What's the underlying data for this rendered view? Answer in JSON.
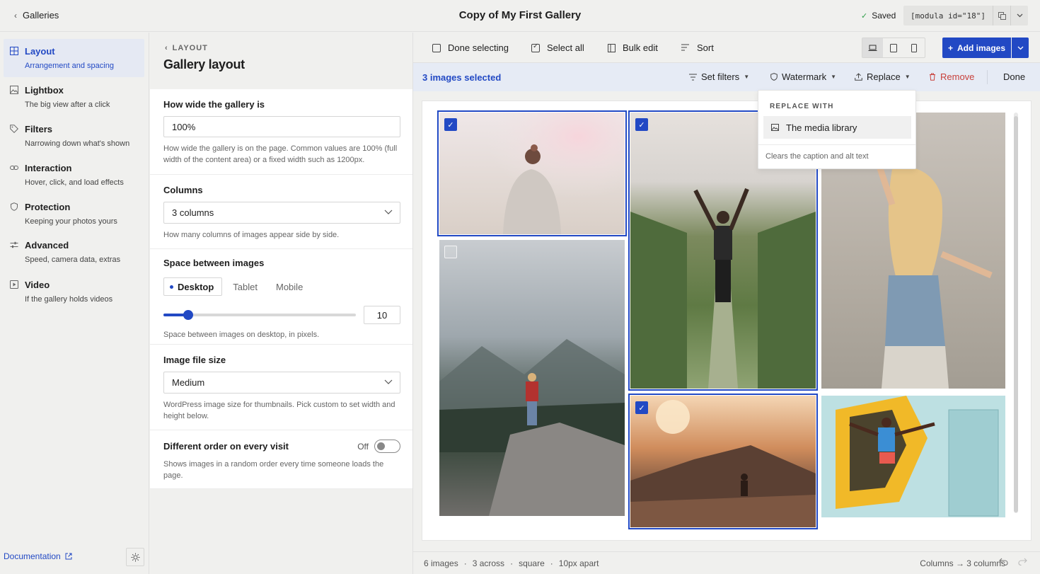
{
  "header": {
    "back_label": "Galleries",
    "title": "Copy of My First Gallery",
    "saved_label": "Saved",
    "shortcode": "[modula id=\"18\"]"
  },
  "nav": {
    "items": [
      {
        "label": "Layout",
        "desc": "Arrangement and spacing",
        "icon": "grid-icon",
        "active": true
      },
      {
        "label": "Lightbox",
        "desc": "The big view after a click",
        "icon": "image-icon",
        "active": false
      },
      {
        "label": "Filters",
        "desc": "Narrowing down what's shown",
        "icon": "tag-icon",
        "active": false
      },
      {
        "label": "Interaction",
        "desc": "Hover, click, and load effects",
        "icon": "link-icon",
        "active": false
      },
      {
        "label": "Protection",
        "desc": "Keeping your photos yours",
        "icon": "shield-icon",
        "active": false
      },
      {
        "label": "Advanced",
        "desc": "Speed, camera data, extras",
        "icon": "sliders-icon",
        "active": false
      },
      {
        "label": "Video",
        "desc": "If the gallery holds videos",
        "icon": "play-icon",
        "active": false
      }
    ],
    "documentation_label": "Documentation"
  },
  "settings": {
    "crumb": "LAYOUT",
    "title": "Gallery layout",
    "width": {
      "label": "How wide the gallery is",
      "value": "100%",
      "help": "How wide the gallery is on the page. Common values are 100% (full width of the content area) or a fixed width such as 1200px."
    },
    "columns": {
      "label": "Columns",
      "value": "3 columns",
      "help": "How many columns of images appear side by side."
    },
    "spacing": {
      "label": "Space between images",
      "tabs": [
        "Desktop",
        "Tablet",
        "Mobile"
      ],
      "active_tab": "Desktop",
      "value": "10",
      "fraction": 0.13,
      "help": "Space between images on desktop, in pixels."
    },
    "file_size": {
      "label": "Image file size",
      "value": "Medium",
      "help": "WordPress image size for thumbnails. Pick custom to set width and height below."
    },
    "random_order": {
      "label": "Different order on every visit",
      "state": "Off",
      "help": "Shows images in a random order every time someone loads the page."
    }
  },
  "toolbar": {
    "done_selecting": "Done selecting",
    "select_all": "Select all",
    "bulk_edit": "Bulk edit",
    "sort": "Sort",
    "add_images": "Add images"
  },
  "selection_bar": {
    "count_label": "3 images selected",
    "set_filters": "Set filters",
    "watermark": "Watermark",
    "replace": "Replace",
    "remove": "Remove",
    "done": "Done"
  },
  "replace_menu": {
    "heading": "REPLACE WITH",
    "item": "The media library",
    "note": "Clears the caption and alt text"
  },
  "status": {
    "count": "6 images",
    "across": "3 across",
    "shape": "square",
    "gap": "10px apart",
    "change": "Columns → 3 columns"
  },
  "colors": {
    "accent": "#2249c4",
    "danger": "#c8413b",
    "saved": "#2e9e48"
  }
}
